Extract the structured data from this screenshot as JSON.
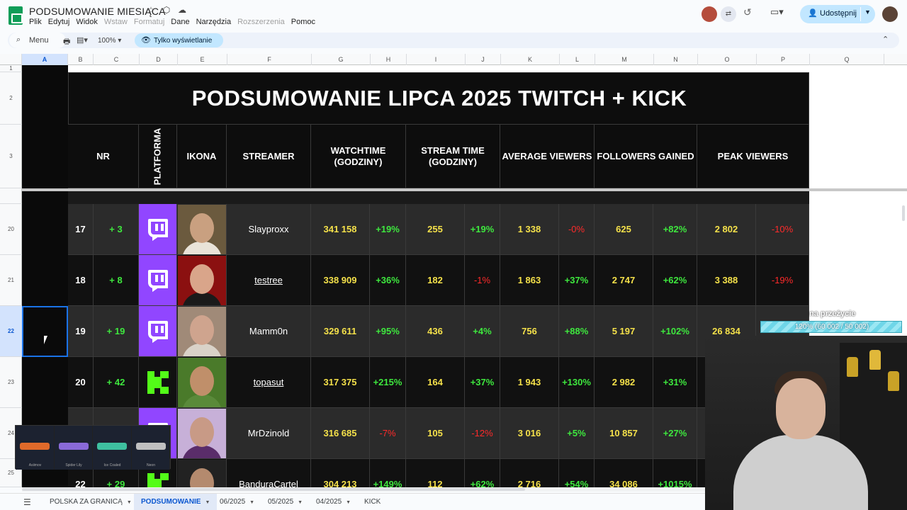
{
  "doc": {
    "title": "PODSUMOWANIE MIESIĄCA",
    "menu": [
      {
        "label": "Plik",
        "disabled": false
      },
      {
        "label": "Edytuj",
        "disabled": false
      },
      {
        "label": "Widok",
        "disabled": false
      },
      {
        "label": "Wstaw",
        "disabled": true
      },
      {
        "label": "Formatuj",
        "disabled": true
      },
      {
        "label": "Dane",
        "disabled": false
      },
      {
        "label": "Narzędzia",
        "disabled": false
      },
      {
        "label": "Rozszerzenia",
        "disabled": true
      },
      {
        "label": "Pomoc",
        "disabled": false
      }
    ],
    "share_label": "Udostępnij"
  },
  "toolbar": {
    "menu_label": "Menu",
    "zoom": "100%",
    "view_only_label": "Tylko wyświetlanie"
  },
  "grid": {
    "columns": [
      "A",
      "B",
      "C",
      "D",
      "E",
      "F",
      "G",
      "H",
      "I",
      "J",
      "K",
      "L",
      "M",
      "N",
      "O",
      "P",
      "Q"
    ],
    "selected_column": "A",
    "rows": [
      "1",
      "2",
      "3",
      "20",
      "21",
      "22",
      "23",
      "24",
      "25"
    ],
    "selected_row": "22"
  },
  "sheet": {
    "title": "PODSUMOWANIE LIPCA 2025 TWITCH + KICK",
    "headers": {
      "nr": "NR",
      "platform": "PLATFORMA",
      "icon": "IKONA",
      "streamer": "STREAMER",
      "watchtime": "WATCHTIME (GODZINY)",
      "stream_time": "STREAM TIME (GODZINY)",
      "avg_viewers": "AVERAGE VIEWERS",
      "followers": "FOLLOWERS GAINED",
      "peak": "PEAK VIEWERS"
    },
    "rows": [
      {
        "nr": "17",
        "change": "+ 3",
        "platform": "twitch",
        "streamer": "Slayproxx",
        "link": false,
        "watchtime": "341 158",
        "watchtime_pct": "+19%",
        "watchtime_pct_neg": false,
        "stream_time": "255",
        "stream_time_pct": "+19%",
        "stream_time_pct_neg": false,
        "avg": "1 338",
        "avg_pct": "-0%",
        "avg_pct_neg": true,
        "followers": "625",
        "followers_pct": "+82%",
        "followers_pct_neg": false,
        "peak": "2 802",
        "peak_pct": "-10%",
        "peak_pct_neg": true
      },
      {
        "nr": "18",
        "change": "+ 8",
        "platform": "twitch",
        "streamer": "testree",
        "link": true,
        "watchtime": "338 909",
        "watchtime_pct": "+36%",
        "watchtime_pct_neg": false,
        "stream_time": "182",
        "stream_time_pct": "-1%",
        "stream_time_pct_neg": true,
        "avg": "1 863",
        "avg_pct": "+37%",
        "avg_pct_neg": false,
        "followers": "2 747",
        "followers_pct": "+62%",
        "followers_pct_neg": false,
        "peak": "3 388",
        "peak_pct": "-19%",
        "peak_pct_neg": true
      },
      {
        "nr": "19",
        "change": "+ 19",
        "platform": "twitch",
        "streamer": "Mamm0n",
        "link": false,
        "watchtime": "329 611",
        "watchtime_pct": "+95%",
        "watchtime_pct_neg": false,
        "stream_time": "436",
        "stream_time_pct": "+4%",
        "stream_time_pct_neg": false,
        "avg": "756",
        "avg_pct": "+88%",
        "avg_pct_neg": false,
        "followers": "5 197",
        "followers_pct": "+102%",
        "followers_pct_neg": false,
        "peak": "26 834",
        "peak_pct": "",
        "peak_pct_neg": false
      },
      {
        "nr": "20",
        "change": "+ 42",
        "platform": "kick",
        "streamer": "topasut",
        "link": true,
        "watchtime": "317 375",
        "watchtime_pct": "+215%",
        "watchtime_pct_neg": false,
        "stream_time": "164",
        "stream_time_pct": "+37%",
        "stream_time_pct_neg": false,
        "avg": "1 943",
        "avg_pct": "+130%",
        "avg_pct_neg": false,
        "followers": "2 982",
        "followers_pct": "+31%",
        "followers_pct_neg": false,
        "peak": "",
        "peak_pct": "",
        "peak_pct_neg": false
      },
      {
        "nr": "",
        "change": "",
        "platform": "twitch",
        "streamer": "MrDzinold",
        "link": false,
        "watchtime": "316 685",
        "watchtime_pct": "-7%",
        "watchtime_pct_neg": true,
        "stream_time": "105",
        "stream_time_pct": "-12%",
        "stream_time_pct_neg": true,
        "avg": "3 016",
        "avg_pct": "+5%",
        "avg_pct_neg": false,
        "followers": "10 857",
        "followers_pct": "+27%",
        "followers_pct_neg": false,
        "peak": "",
        "peak_pct": "",
        "peak_pct_neg": false
      },
      {
        "nr": "22",
        "change": "+ 29",
        "platform": "kick",
        "streamer": "BanduraCartel",
        "link": false,
        "watchtime": "304 213",
        "watchtime_pct": "+149%",
        "watchtime_pct_neg": false,
        "stream_time": "112",
        "stream_time_pct": "+62%",
        "stream_time_pct_neg": false,
        "avg": "2 716",
        "avg_pct": "+54%",
        "avg_pct_neg": false,
        "followers": "34 086",
        "followers_pct": "+1015%",
        "followers_pct_neg": false,
        "peak": "",
        "peak_pct": "",
        "peak_pct_neg": false
      }
    ]
  },
  "overlay": {
    "label": "na przeżycie",
    "bar_text": "120% (60 002 / 50 002)",
    "skins": [
      "Asiimov",
      "Spider Lily",
      "Ice Coaled",
      "Neon"
    ]
  },
  "tabs": [
    {
      "label": "POLSKA ZA GRANICĄ",
      "active": false
    },
    {
      "label": "PODSUMOWANIE",
      "active": true
    },
    {
      "label": "06/2025",
      "active": false
    },
    {
      "label": "05/2025",
      "active": false
    },
    {
      "label": "04/2025",
      "active": false
    },
    {
      "label": "KICK",
      "active": false
    }
  ],
  "colors": {
    "sheet_bg": "#0d0d0d",
    "row_alt": "#2b2b2b",
    "yellow": "#f5e14a",
    "green": "#3ee83e",
    "red": "#ff2a2a",
    "twitch": "#9146ff",
    "kick": "#53fc18",
    "accent": "#c2e7ff"
  }
}
